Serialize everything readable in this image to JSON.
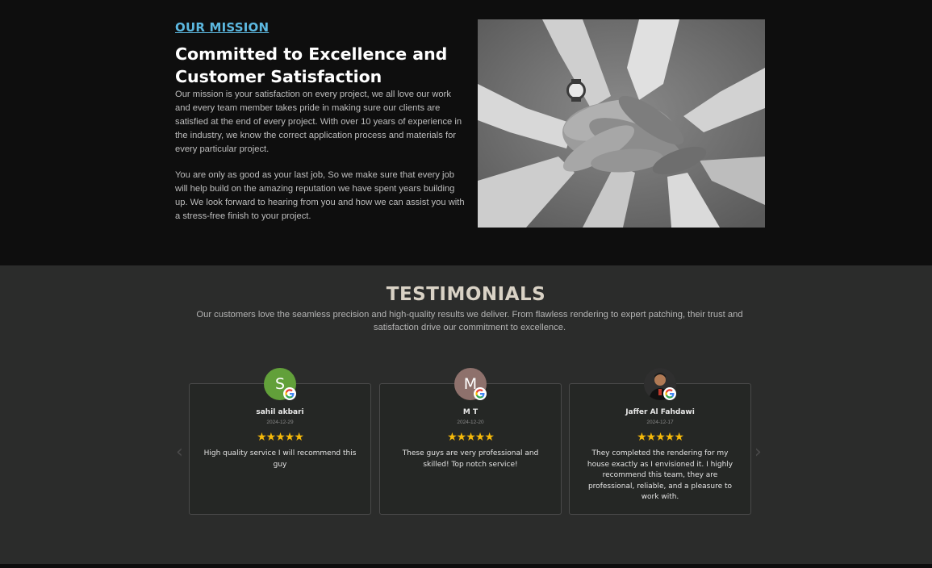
{
  "mission": {
    "eyebrow": "OUR MISSION",
    "title": "Committed to Excellence and Customer Satisfaction",
    "paragraph1": "Our mission is your satisfaction on every project, we all love our work and every team member takes pride in making sure our clients are satisfied at the end of every project. With over 10 years of experience in the industry, we know the correct application process and materials for every particular project.",
    "paragraph2": "You are only as good as your last job, So we make sure that every job will help build on the amazing reputation we have spent years building up. We look forward to hearing from you and how we can assist you with a stress-free finish to your project.",
    "photo_icon": "team-hands-stacked-photo"
  },
  "testimonials": {
    "heading": "TESTIMONIALS",
    "subheading": "Our customers love the seamless precision and high-quality results we deliver. From flawless rendering to expert patching, their trust and satisfaction drive our commitment to excellence.",
    "prev_arrow": "‹",
    "next_arrow": "›",
    "reviews": [
      {
        "initial": "S",
        "avatar_color": "#62a03a",
        "name": "sahil akbari",
        "date": "2024-12-29",
        "stars": "★★★★★",
        "rating": 5,
        "text": "High quality service I will recommend this guy"
      },
      {
        "initial": "M",
        "avatar_color": "#8e716c",
        "name": "M T",
        "date": "2024-12-20",
        "stars": "★★★★★",
        "rating": 5,
        "text": "These guys are very professional and skilled! Top notch service!"
      },
      {
        "initial": "",
        "avatar_color": "#2a2a2a",
        "name": "Jaffer Al Fahdawi",
        "date": "2024-12-17",
        "stars": "★★★★★",
        "rating": 5,
        "text": "They completed the rendering for my house exactly as I envisioned it. I highly recommend this team, they are professional, reliable, and a pleasure to work with."
      }
    ]
  },
  "colors": {
    "accent": "#5cb8e0",
    "star": "#f5b90a",
    "section_bg": "#2b2c2b"
  }
}
